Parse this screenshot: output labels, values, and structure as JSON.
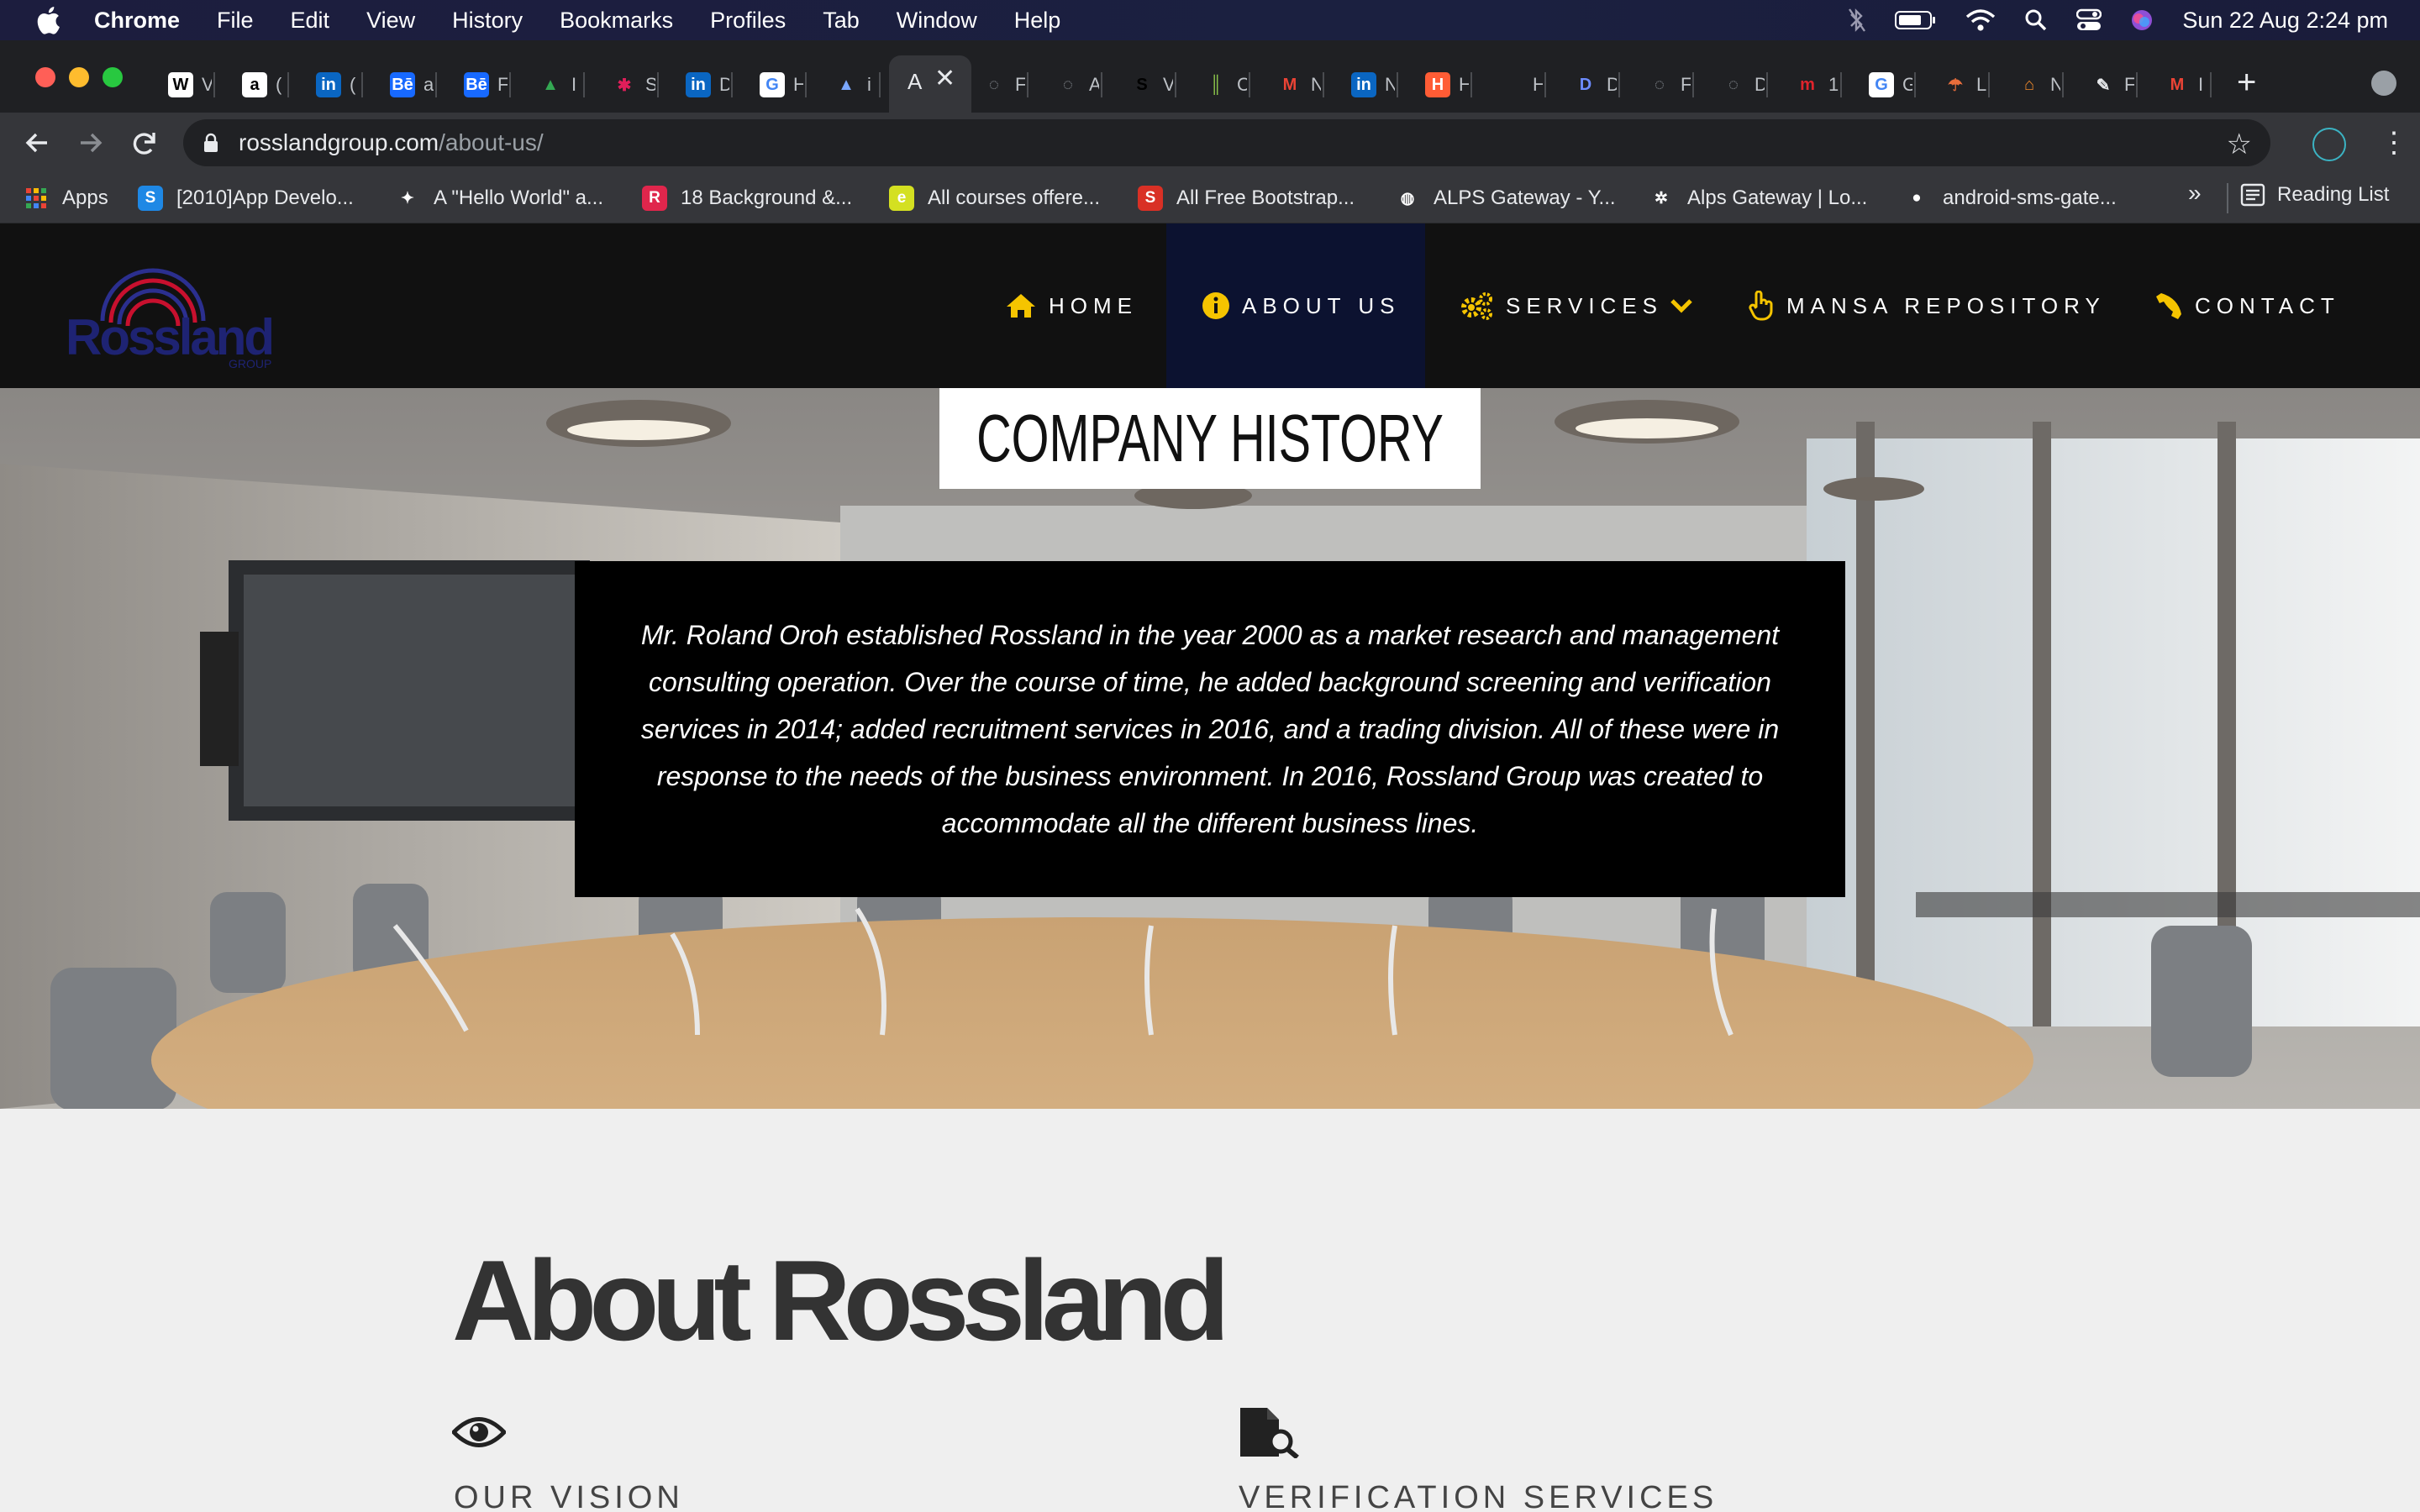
{
  "menubar": {
    "app": "Chrome",
    "items": [
      "File",
      "Edit",
      "View",
      "History",
      "Bookmarks",
      "Profiles",
      "Tab",
      "Window",
      "Help"
    ],
    "clock": "Sun 22 Aug  2:24 pm"
  },
  "tabs": [
    {
      "icon": "wikipedia-icon",
      "glyph": "W",
      "bg": "#ffffff",
      "fg": "#000000",
      "title": "V"
    },
    {
      "icon": "amazon-icon",
      "glyph": "a",
      "bg": "#ffffff",
      "fg": "#000000",
      "title": "("
    },
    {
      "icon": "linkedin-icon",
      "glyph": "in",
      "bg": "#0a66c2",
      "fg": "#ffffff",
      "title": "("
    },
    {
      "icon": "behance-icon",
      "glyph": "Bē",
      "bg": "#1769ff",
      "fg": "#ffffff",
      "title": "a"
    },
    {
      "icon": "behance-icon",
      "glyph": "Bē",
      "bg": "#1769ff",
      "fg": "#ffffff",
      "title": "F"
    },
    {
      "icon": "google-drive-icon",
      "glyph": "▲",
      "bg": "transparent",
      "fg": "#34a853",
      "title": "I"
    },
    {
      "icon": "slack-icon",
      "glyph": "✱",
      "bg": "transparent",
      "fg": "#e01e5a",
      "title": "S"
    },
    {
      "icon": "linkedin-icon",
      "glyph": "in",
      "bg": "#0a66c2",
      "fg": "#ffffff",
      "title": "D"
    },
    {
      "icon": "google-icon",
      "glyph": "G",
      "bg": "#ffffff",
      "fg": "#4285f4",
      "title": "H"
    },
    {
      "icon": "triangle-app-icon",
      "glyph": "▲",
      "bg": "transparent",
      "fg": "#7aa7ff",
      "title": "i"
    },
    {
      "icon": "globe-icon",
      "glyph": "◌",
      "bg": "transparent",
      "fg": "#9aa0a6",
      "title": "F"
    },
    {
      "icon": "globe-icon",
      "glyph": "◌",
      "bg": "transparent",
      "fg": "#9aa0a6",
      "title": "A"
    },
    {
      "icon": "generic-site-icon",
      "glyph": "S",
      "bg": "transparent",
      "fg": "#000000",
      "title": "V"
    },
    {
      "icon": "green-bars-icon",
      "glyph": "║",
      "bg": "transparent",
      "fg": "#8ac34a",
      "title": "C"
    },
    {
      "icon": "gmail-icon",
      "glyph": "M",
      "bg": "transparent",
      "fg": "#ea4335",
      "title": "N"
    },
    {
      "icon": "linkedin-icon",
      "glyph": "in",
      "bg": "#0a66c2",
      "fg": "#ffffff",
      "title": "N"
    },
    {
      "icon": "hubspot-icon",
      "glyph": "H",
      "bg": "#ff5c35",
      "fg": "#ffffff",
      "title": "H"
    },
    {
      "icon": "blank-icon",
      "glyph": "",
      "bg": "transparent",
      "fg": "#ffffff",
      "title": "H"
    },
    {
      "icon": "d-app-icon",
      "glyph": "D",
      "bg": "transparent",
      "fg": "#6d8cff",
      "title": "D"
    },
    {
      "icon": "globe-icon",
      "glyph": "◌",
      "bg": "transparent",
      "fg": "#9aa0a6",
      "title": "F"
    },
    {
      "icon": "globe-icon",
      "glyph": "◌",
      "bg": "transparent",
      "fg": "#9aa0a6",
      "title": "D"
    },
    {
      "icon": "m-app-icon",
      "glyph": "m",
      "bg": "transparent",
      "fg": "#e0242c",
      "title": "1"
    },
    {
      "icon": "google-icon",
      "glyph": "G",
      "bg": "#ffffff",
      "fg": "#4285f4",
      "title": "G"
    },
    {
      "icon": "umbrella-icon",
      "glyph": "☂",
      "bg": "transparent",
      "fg": "#e86d3b",
      "title": "L"
    },
    {
      "icon": "house-app-icon",
      "glyph": "⌂",
      "bg": "transparent",
      "fg": "#f28a2b",
      "title": "N"
    },
    {
      "icon": "feather-icon",
      "glyph": "✎",
      "bg": "transparent",
      "fg": "#e8eaed",
      "title": "F"
    },
    {
      "icon": "gmail-icon",
      "glyph": "M",
      "bg": "transparent",
      "fg": "#ea4335",
      "title": "I"
    }
  ],
  "active_tab": {
    "title": "A"
  },
  "url": {
    "domain": "rosslandgroup.com",
    "path": "/about-us/"
  },
  "bookmarks": [
    {
      "icon": "apps-grid-icon",
      "label": "Apps",
      "bg": "transparent",
      "glyph": ""
    },
    {
      "icon": "stack-s-icon",
      "label": "[2010]App Develo...",
      "bg": "#1e88e5",
      "glyph": "S"
    },
    {
      "icon": "android-icon",
      "label": "A \"Hello World\" a...",
      "bg": "transparent",
      "glyph": "✦"
    },
    {
      "icon": "r-icon",
      "label": "18 Background &...",
      "bg": "#e0264c",
      "glyph": "R"
    },
    {
      "icon": "courses-icon",
      "label": "All courses offere...",
      "bg": "#d4e021",
      "glyph": "e"
    },
    {
      "icon": "s-red-icon",
      "label": "All Free Bootstrap...",
      "bg": "#d93025",
      "glyph": "S"
    },
    {
      "icon": "globe-icon",
      "label": "ALPS Gateway - Y...",
      "bg": "transparent",
      "glyph": "◍"
    },
    {
      "icon": "pinwheel-icon",
      "label": "Alps Gateway | Lo...",
      "bg": "transparent",
      "glyph": "✲"
    },
    {
      "icon": "github-icon",
      "label": "android-sms-gate...",
      "bg": "transparent",
      "glyph": "●"
    }
  ],
  "bookmarks_more": "»",
  "reading_list": "Reading List",
  "site": {
    "logo_text": "Rossland",
    "logo_sub": "GROUP",
    "nav": [
      {
        "label": "HOME"
      },
      {
        "label": "ABOUT US"
      },
      {
        "label": "SERVICES"
      },
      {
        "label": "MANSA REPOSITORY"
      },
      {
        "label": "CONTACT"
      }
    ],
    "hero_title": "COMPANY HISTORY",
    "history": "Mr. Roland Oroh established Rossland in the year 2000 as a market research and management consulting operation. Over the course of time, he added background screening and verification services in 2014; added recruitment services in 2016, and a trading division. All of these were in response to the needs of the business environment. In 2016, Rossland Group was created to accommodate all the different business lines.",
    "about_title": "About Rossland",
    "vision_label": "OUR VISION",
    "verification_label": "VERIFICATION SERVICES"
  },
  "colors": {
    "nav_icon": "#f5c400",
    "header_bg": "#111111",
    "active_nav_bg": "#0c1230",
    "about_text": "#333333"
  }
}
